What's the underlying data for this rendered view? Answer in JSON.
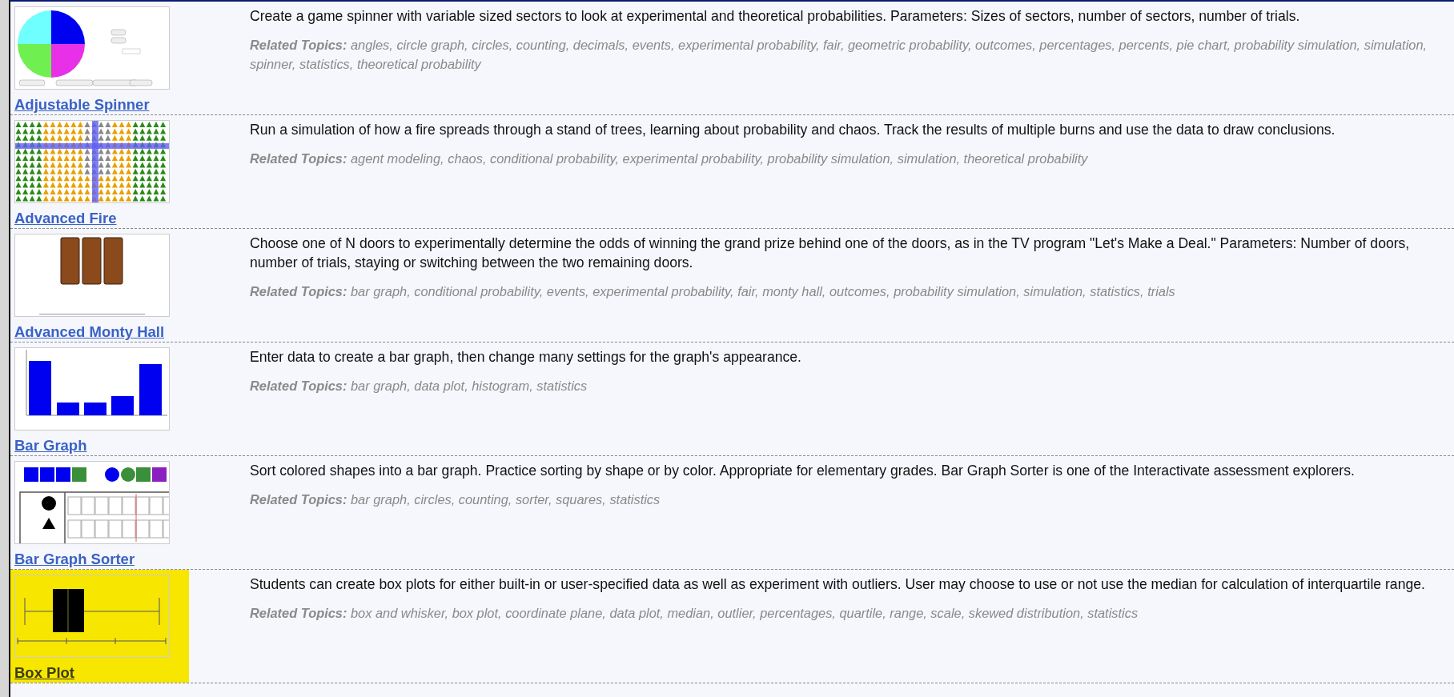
{
  "activities": [
    {
      "title": "Adjustable Spinner",
      "kind": "spinner",
      "highlighted": false,
      "description": "Create a game spinner with variable sized sectors to look at experimental and theoretical probabilities. Parameters: Sizes of sectors, number of sectors, number of trials.",
      "topics": "**Related Topics:** angles, circle graph, circles, counting, decimals, events, experimental probability, fair, geometric probability, outcomes, percentages, percents, pie chart, probability simulation, simulation, spinner, statistics, theoretical probability"
    },
    {
      "title": "Advanced Fire",
      "kind": "fire",
      "highlighted": false,
      "description": "Run a simulation of how a fire spreads through a stand of trees, learning about probability and chaos. Track the results of multiple burns and use the data to draw conclusions.",
      "topics": "**Related Topics:** agent modeling, chaos, conditional probability, experimental probability, probability simulation, simulation, theoretical probability"
    },
    {
      "title": "Advanced Monty Hall",
      "kind": "doors",
      "highlighted": false,
      "description": "Choose one of N doors to experimentally determine the odds of winning the grand prize behind one of the doors, as in the TV program \"Let's Make a Deal.\" Parameters: Number of doors, number of trials, staying or switching between the two remaining doors.",
      "topics": "**Related Topics:** bar graph, conditional probability, events, experimental probability, fair, monty hall, outcomes, probability simulation, simulation, statistics, trials"
    },
    {
      "title": "Bar Graph",
      "kind": "bars",
      "highlighted": false,
      "description": "Enter data to create a bar graph, then change many settings for the graph's appearance.",
      "topics": "**Related Topics:** bar graph, data plot, histogram, statistics"
    },
    {
      "title": "Bar Graph Sorter",
      "kind": "sorter",
      "highlighted": false,
      "description": "Sort colored shapes into a bar graph. Practice sorting by shape or by color. Appropriate for elementary grades. Bar Graph Sorter is one of the Interactivate assessment explorers.",
      "topics": "**Related Topics:** bar graph, circles, counting, sorter, squares, statistics"
    },
    {
      "title": "Box Plot",
      "kind": "boxplot",
      "highlighted": true,
      "description": "Students can create box plots for either built-in or user-specified data as well as experiment with outliers. User may choose to use or not use the median for calculation of interquartile range.",
      "topics": "**Related Topics:** box and whisker, box plot, coordinate plane, data plot, median, outlier, percentages, quartile, range, scale, skewed distribution, statistics"
    }
  ]
}
